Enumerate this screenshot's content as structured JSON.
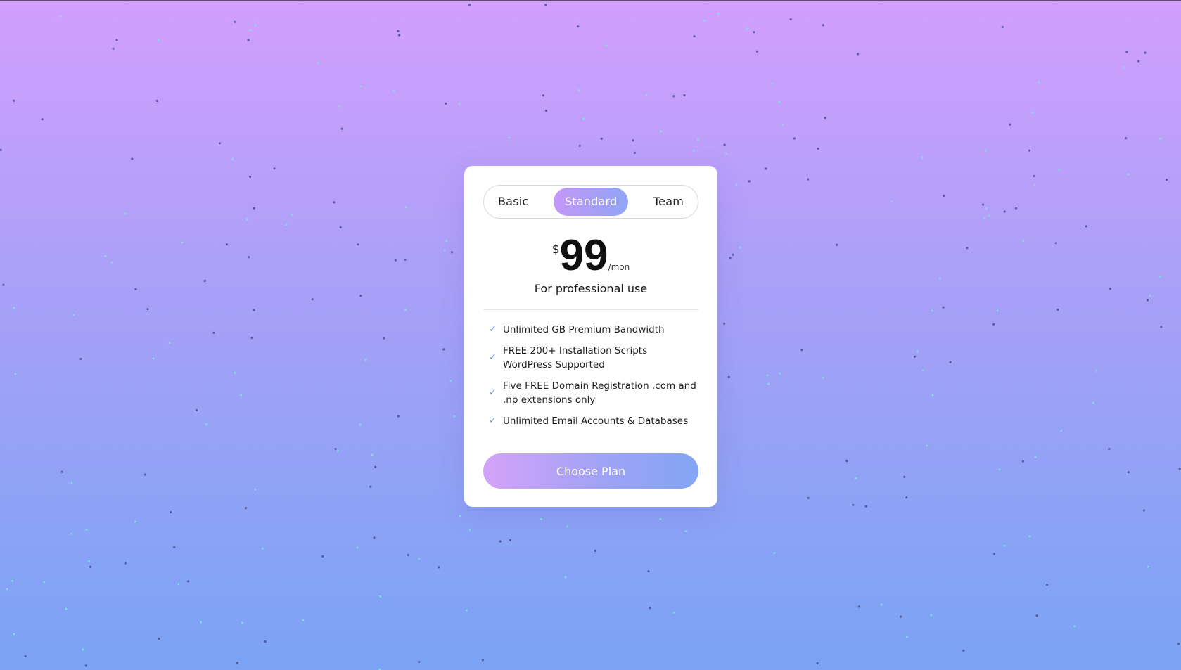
{
  "colors": {
    "background_top": "#d29ffd",
    "background_bottom": "#7aa3f5",
    "card": "#ffffff",
    "accent_start": "#c497f8",
    "accent_end": "#8fa5f5",
    "check": "#7a8ff0",
    "particle_dark": "#4a4a8a",
    "particle_light": "#7fe0e8"
  },
  "plan_tabs": [
    {
      "label": "Basic",
      "active": false
    },
    {
      "label": "Standard",
      "active": true
    },
    {
      "label": "Team",
      "active": false
    }
  ],
  "price": {
    "currency": "$",
    "amount": "99",
    "period": "/mon"
  },
  "subtitle": "For professional use",
  "features": [
    {
      "icon": "check-icon",
      "text": "Unlimited GB Premium Bandwidth"
    },
    {
      "icon": "check-icon",
      "text": "FREE 200+ Installation Scripts WordPress Supported"
    },
    {
      "icon": "check-icon",
      "text": "Five FREE Domain Registration .com and .np extensions only"
    },
    {
      "icon": "check-icon",
      "text": "Unlimited Email Accounts & Databases"
    }
  ],
  "cta": {
    "label": "Choose Plan"
  }
}
